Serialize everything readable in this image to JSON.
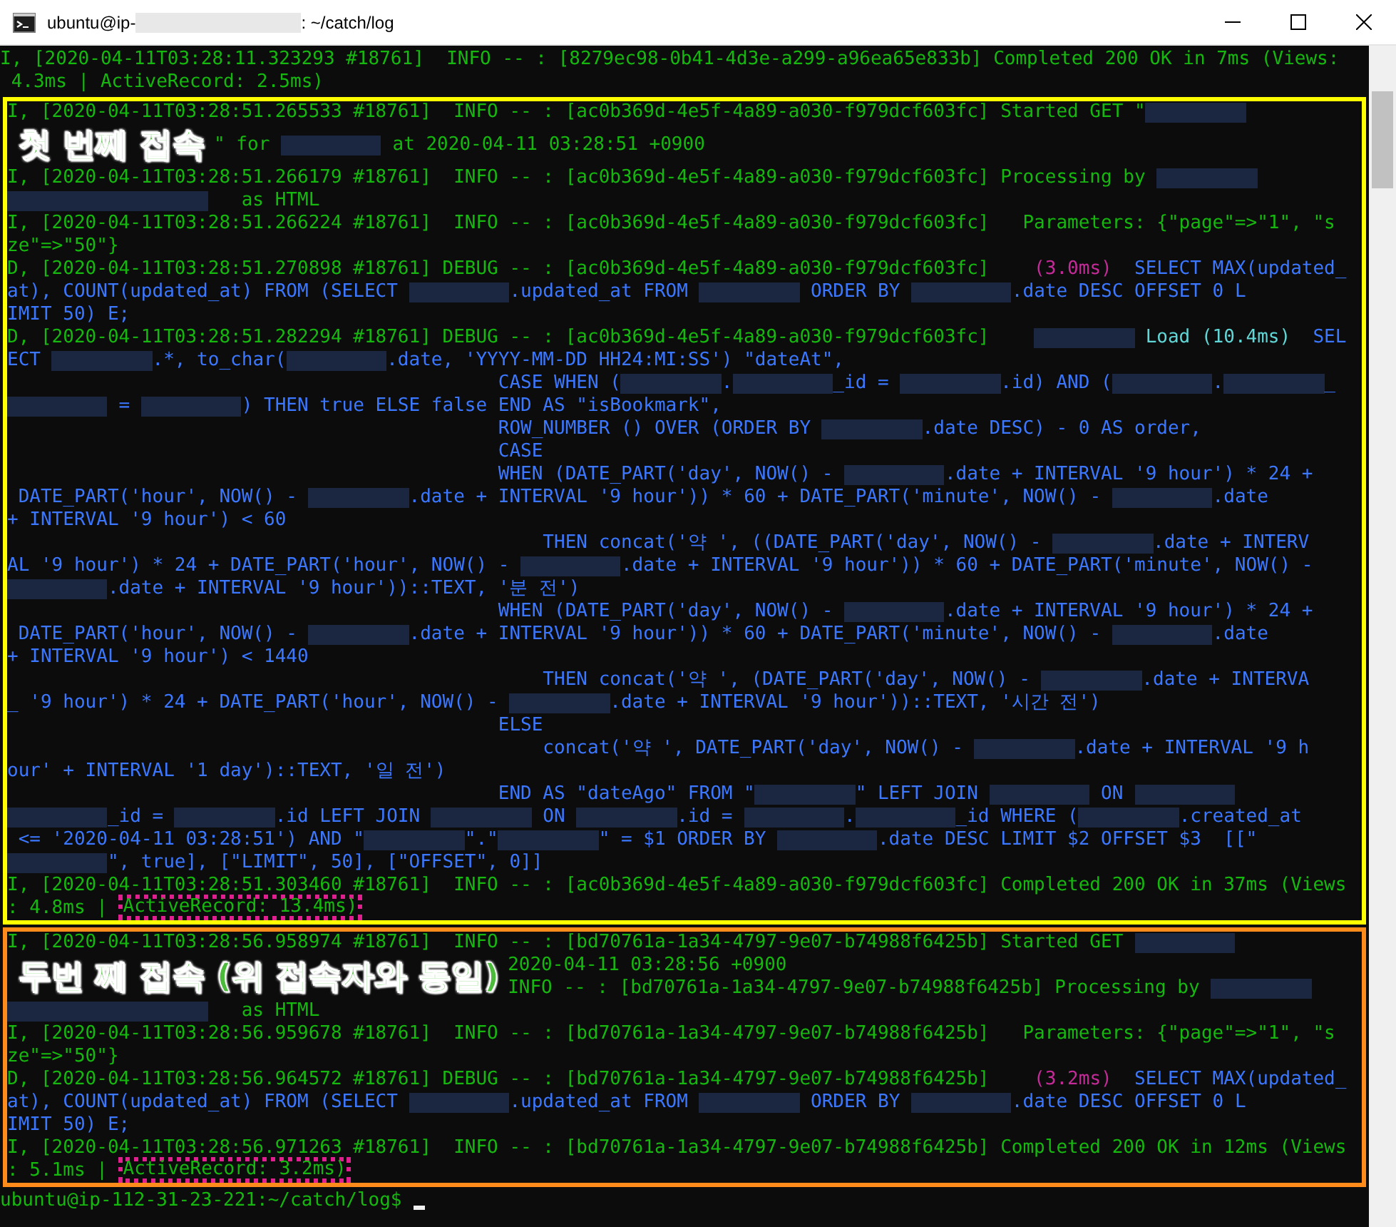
{
  "window": {
    "title": [
      {
        "kind": "text",
        "text": "ubuntu@ip-"
      },
      {
        "kind": "redacted"
      },
      {
        "kind": "text",
        "text": ": ~/catch/log"
      }
    ]
  },
  "terminal": {
    "blocks": [
      {
        "kind": "plain",
        "lines": [
          {
            "segments": [
              {
                "kind": "log",
                "text": "I, [2020-04-11T03:28:11.323293 #18761]  INFO -- : [8279ec98-0b41-4d3e-a299-a96ea65e833b] Completed 200 OK in 7ms (Views:"
              }
            ]
          },
          {
            "segments": [
              {
                "kind": "log",
                "text": " 4.3ms | ActiveRecord: 2.5ms)"
              }
            ]
          }
        ]
      },
      {
        "kind": "section",
        "color": "#ffff00",
        "lines": [
          {
            "segments": [
              {
                "kind": "log",
                "text": "I, [2020-04-11T03:28:51.265533 #18761]  INFO -- : [ac0b369d-4e5f-4a89-a030-f979dcf603fc] Started GET \""
              },
              {
                "kind": "redacted"
              }
            ]
          },
          {
            "note": "첫 번째 접속",
            "lines": [
              [
                {
                  "kind": "log",
                  "text": "\" for "
                },
                {
                  "kind": "redacted"
                },
                {
                  "kind": "log",
                  "text": " at 2020-04-11 03:28:51 +0900"
                }
              ]
            ]
          },
          {
            "segments": [
              {
                "kind": "log",
                "text": "I, [2020-04-11T03:28:51.266179 #18761]  INFO -- : [ac0b369d-4e5f-4a89-a030-f979dcf603fc] Processing by "
              },
              {
                "kind": "redacted"
              }
            ]
          },
          {
            "segments": [
              {
                "kind": "redacted"
              },
              {
                "kind": "redacted"
              },
              {
                "kind": "log",
                "text": "   as HTML"
              }
            ]
          },
          {
            "segments": [
              {
                "kind": "log",
                "text": "I, [2020-04-11T03:28:51.266224 #18761]  INFO -- : [ac0b369d-4e5f-4a89-a030-f979dcf603fc]   Parameters: {\"page\"=>\"1\", \"s"
              }
            ]
          },
          {
            "segments": [
              {
                "kind": "log",
                "text": "ze\"=>\"50\"}"
              }
            ]
          },
          {
            "segments": [
              {
                "kind": "log",
                "text": "D, [2020-04-11T03:28:51.270898 #18761] DEBUG -- : [ac0b369d-4e5f-4a89-a030-f979dcf603fc]"
              },
              {
                "kind": "time",
                "text": "    (3.0ms)"
              },
              {
                "kind": "sql",
                "text": "  SELECT MAX(updated_"
              }
            ]
          },
          {
            "segments": [
              {
                "kind": "sql",
                "text": "at), COUNT(updated_at) FROM (SELECT "
              },
              {
                "kind": "redacted"
              },
              {
                "kind": "sql",
                "text": ".updated_at FROM "
              },
              {
                "kind": "redacted"
              },
              {
                "kind": "sql",
                "text": " ORDER BY "
              },
              {
                "kind": "redacted"
              },
              {
                "kind": "sql",
                "text": ".date DESC OFFSET 0 L"
              }
            ]
          },
          {
            "segments": [
              {
                "kind": "sql",
                "text": "IMIT 50) E;"
              }
            ]
          },
          {
            "segments": [
              {
                "kind": "log",
                "text": "D, [2020-04-11T03:28:51.282294 #18761] DEBUG -- : [ac0b369d-4e5f-4a89-a030-f979dcf603fc]    "
              },
              {
                "kind": "redacted"
              },
              {
                "kind": "load",
                "text": " Load (10.4ms)"
              },
              {
                "kind": "sql",
                "text": "  SEL"
              }
            ]
          },
          {
            "segments": [
              {
                "kind": "sql",
                "text": "ECT "
              },
              {
                "kind": "redacted"
              },
              {
                "kind": "sql",
                "text": ".*, to_char("
              },
              {
                "kind": "redacted"
              },
              {
                "kind": "sql",
                "text": ".date, 'YYYY-MM-DD HH24:MI:SS') \"dateAt\","
              }
            ]
          },
          {
            "segments": [
              {
                "kind": "sql",
                "text": "                                            CASE WHEN ("
              },
              {
                "kind": "redacted"
              },
              {
                "kind": "sql",
                "text": "."
              },
              {
                "kind": "redacted"
              },
              {
                "kind": "sql",
                "text": "_id = "
              },
              {
                "kind": "redacted"
              },
              {
                "kind": "sql",
                "text": ".id) AND ("
              },
              {
                "kind": "redacted"
              },
              {
                "kind": "sql",
                "text": "."
              },
              {
                "kind": "redacted"
              },
              {
                "kind": "sql",
                "text": "_"
              }
            ]
          },
          {
            "segments": [
              {
                "kind": "redacted"
              },
              {
                "kind": "sql",
                "text": " = "
              },
              {
                "kind": "redacted"
              },
              {
                "kind": "sql",
                "text": ") THEN true ELSE false END AS \"isBookmark\","
              }
            ]
          },
          {
            "segments": [
              {
                "kind": "sql",
                "text": "                                            ROW_NUMBER () OVER (ORDER BY "
              },
              {
                "kind": "redacted"
              },
              {
                "kind": "sql",
                "text": ".date DESC) - 0 AS order,"
              }
            ]
          },
          {
            "segments": [
              {
                "kind": "sql",
                "text": "                                            CASE"
              }
            ]
          },
          {
            "segments": [
              {
                "kind": "sql",
                "text": "                                            WHEN (DATE_PART('day', NOW() - "
              },
              {
                "kind": "redacted"
              },
              {
                "kind": "sql",
                "text": ".date + INTERVAL '9 hour') * 24 +"
              }
            ]
          },
          {
            "segments": [
              {
                "kind": "sql",
                "text": " DATE_PART('hour', NOW() - "
              },
              {
                "kind": "redacted"
              },
              {
                "kind": "sql",
                "text": ".date + INTERVAL '9 hour')) * 60 + DATE_PART('minute', NOW() - "
              },
              {
                "kind": "redacted"
              },
              {
                "kind": "sql",
                "text": ".date"
              }
            ]
          },
          {
            "segments": [
              {
                "kind": "sql",
                "text": "+ INTERVAL '9 hour') < 60"
              }
            ]
          },
          {
            "segments": [
              {
                "kind": "sql",
                "text": "                                                THEN concat('약 ', ((DATE_PART('day', NOW() - "
              },
              {
                "kind": "redacted"
              },
              {
                "kind": "sql",
                "text": ".date + INTERV"
              }
            ]
          },
          {
            "segments": [
              {
                "kind": "sql",
                "text": "AL '9 hour') * 24 + DATE_PART('hour', NOW() - "
              },
              {
                "kind": "redacted"
              },
              {
                "kind": "sql",
                "text": ".date + INTERVAL '9 hour')) * 60 + DATE_PART('minute', NOW() -"
              }
            ]
          },
          {
            "segments": [
              {
                "kind": "redacted"
              },
              {
                "kind": "sql",
                "text": ".date + INTERVAL '9 hour'))::TEXT, '분 전')"
              }
            ]
          },
          {
            "segments": [
              {
                "kind": "sql",
                "text": "                                            WHEN (DATE_PART('day', NOW() - "
              },
              {
                "kind": "redacted"
              },
              {
                "kind": "sql",
                "text": ".date + INTERVAL '9 hour') * 24 +"
              }
            ]
          },
          {
            "segments": [
              {
                "kind": "sql",
                "text": " DATE_PART('hour', NOW() - "
              },
              {
                "kind": "redacted"
              },
              {
                "kind": "sql",
                "text": ".date + INTERVAL '9 hour')) * 60 + DATE_PART('minute', NOW() - "
              },
              {
                "kind": "redacted"
              },
              {
                "kind": "sql",
                "text": ".date"
              }
            ]
          },
          {
            "segments": [
              {
                "kind": "sql",
                "text": "+ INTERVAL '9 hour') < 1440"
              }
            ]
          },
          {
            "segments": [
              {
                "kind": "sql",
                "text": "                                                THEN concat('약 ', (DATE_PART('day', NOW() - "
              },
              {
                "kind": "redacted"
              },
              {
                "kind": "sql",
                "text": ".date + INTERVA"
              }
            ]
          },
          {
            "segments": [
              {
                "kind": "sql",
                "text": "_ '9 hour') * 24 + DATE_PART('hour', NOW() - "
              },
              {
                "kind": "redacted"
              },
              {
                "kind": "sql",
                "text": ".date + INTERVAL '9 hour'))::TEXT, '시간 전')"
              }
            ]
          },
          {
            "segments": [
              {
                "kind": "sql",
                "text": "                                            ELSE"
              }
            ]
          },
          {
            "segments": [
              {
                "kind": "sql",
                "text": "                                                concat('약 ', DATE_PART('day', NOW() - "
              },
              {
                "kind": "redacted"
              },
              {
                "kind": "sql",
                "text": ".date + INTERVAL '9 h"
              }
            ]
          },
          {
            "segments": [
              {
                "kind": "sql",
                "text": "our' + INTERVAL '1 day')::TEXT, '일 전')"
              }
            ]
          },
          {
            "segments": [
              {
                "kind": "sql",
                "text": "                                            END AS \"dateAgo\" FROM \""
              },
              {
                "kind": "redacted"
              },
              {
                "kind": "sql",
                "text": "\" LEFT JOIN "
              },
              {
                "kind": "redacted"
              },
              {
                "kind": "sql",
                "text": " ON "
              },
              {
                "kind": "redacted"
              }
            ]
          },
          {
            "segments": [
              {
                "kind": "redacted"
              },
              {
                "kind": "sql",
                "text": "_id = "
              },
              {
                "kind": "redacted"
              },
              {
                "kind": "sql",
                "text": ".id LEFT JOIN "
              },
              {
                "kind": "redacted"
              },
              {
                "kind": "sql",
                "text": " ON "
              },
              {
                "kind": "redacted"
              },
              {
                "kind": "sql",
                "text": ".id = "
              },
              {
                "kind": "redacted"
              },
              {
                "kind": "sql",
                "text": "."
              },
              {
                "kind": "redacted"
              },
              {
                "kind": "sql",
                "text": "_id WHERE ("
              },
              {
                "kind": "redacted"
              },
              {
                "kind": "sql",
                "text": ".created_at"
              }
            ]
          },
          {
            "segments": [
              {
                "kind": "sql",
                "text": " <= '2020-04-11 03:28:51') AND \""
              },
              {
                "kind": "redacted"
              },
              {
                "kind": "sql",
                "text": "\".\""
              },
              {
                "kind": "redacted"
              },
              {
                "kind": "sql",
                "text": "\" = $1 ORDER BY "
              },
              {
                "kind": "redacted"
              },
              {
                "kind": "sql",
                "text": ".date DESC LIMIT $2 OFFSET $3  [[\""
              }
            ]
          },
          {
            "segments": [
              {
                "kind": "redacted"
              },
              {
                "kind": "sql",
                "text": "\", true], [\"LIMIT\", 50], [\"OFFSET\", 0]]"
              }
            ]
          },
          {
            "segments": [
              {
                "kind": "log",
                "text": "I, [2020-04-11T03:28:51.303460 #18761]  INFO -- : [ac0b369d-4e5f-4a89-a030-f979dcf603fc] Completed 200 OK in 37ms (Views"
              }
            ]
          },
          {
            "segments": [
              {
                "kind": "log",
                "text": ": 4.8ms | "
              },
              {
                "kind": "marked",
                "text": "ActiveRecord: 13.4ms)"
              }
            ]
          }
        ]
      },
      {
        "kind": "section",
        "color": "#ff8c1a",
        "lines": [
          {
            "segments": [
              {
                "kind": "log",
                "text": "I, [2020-04-11T03:28:56.958974 #18761]  INFO -- : [bd70761a-1a34-4797-9e07-b74988f6425b] Started GET "
              },
              {
                "kind": "redacted"
              }
            ]
          },
          {
            "note": "두번 째 접속 (위 접속자와 동일)",
            "lines": [
              [
                {
                  "kind": "log",
                  "text": "2020-04-11 03:28:56 +0900"
                }
              ],
              [
                {
                  "kind": "log",
                  "text": "INFO -- : [bd70761a-1a34-4797-9e07-b74988f6425b] Processing by "
                },
                {
                  "kind": "redacted"
                }
              ]
            ]
          },
          {
            "segments": [
              {
                "kind": "redacted"
              },
              {
                "kind": "redacted"
              },
              {
                "kind": "log",
                "text": "   as HTML"
              }
            ]
          },
          {
            "segments": [
              {
                "kind": "log",
                "text": "I, [2020-04-11T03:28:56.959678 #18761]  INFO -- : [bd70761a-1a34-4797-9e07-b74988f6425b]   Parameters: {\"page\"=>\"1\", \"s"
              }
            ]
          },
          {
            "segments": [
              {
                "kind": "log",
                "text": "ze\"=>\"50\"}"
              }
            ]
          },
          {
            "segments": [
              {
                "kind": "log",
                "text": "D, [2020-04-11T03:28:56.964572 #18761] DEBUG -- : [bd70761a-1a34-4797-9e07-b74988f6425b]"
              },
              {
                "kind": "time",
                "text": "    (3.2ms)"
              },
              {
                "kind": "sql",
                "text": "  SELECT MAX(updated_"
              }
            ]
          },
          {
            "segments": [
              {
                "kind": "sql",
                "text": "at), COUNT(updated_at) FROM (SELECT "
              },
              {
                "kind": "redacted"
              },
              {
                "kind": "sql",
                "text": ".updated_at FROM "
              },
              {
                "kind": "redacted"
              },
              {
                "kind": "sql",
                "text": " ORDER BY "
              },
              {
                "kind": "redacted"
              },
              {
                "kind": "sql",
                "text": ".date DESC OFFSET 0 L"
              }
            ]
          },
          {
            "segments": [
              {
                "kind": "sql",
                "text": "IMIT 50) E;"
              }
            ]
          },
          {
            "segments": [
              {
                "kind": "log",
                "text": "I, [2020-04-11T03:28:56.971263 #18761]  INFO -- : [bd70761a-1a34-4797-9e07-b74988f6425b] Completed 200 OK in 12ms (Views"
              }
            ]
          },
          {
            "segments": [
              {
                "kind": "log",
                "text": ": 5.1ms | "
              },
              {
                "kind": "marked",
                "text": "ActiveRecord: 3.2ms)"
              }
            ]
          }
        ]
      },
      {
        "kind": "plain",
        "lines": [
          {
            "segments": [
              {
                "kind": "prompt",
                "text": "ubuntu@ip-112-31-23-221:~/catch/log$ "
              },
              {
                "kind": "cursor"
              }
            ]
          }
        ]
      }
    ]
  }
}
